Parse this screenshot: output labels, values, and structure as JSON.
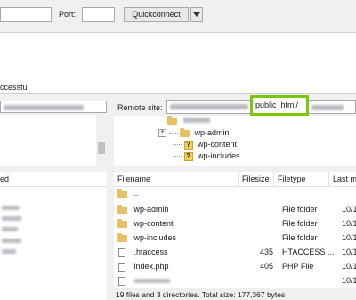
{
  "quickconnect_bar": {
    "port_label": "Port:",
    "quickconnect_label": "Quickconnect",
    "dropdown_icon": "triangle-down-icon"
  },
  "message_log": {
    "visible_line": "ccessful"
  },
  "remote_site": {
    "label": "Remote site:",
    "path_highlight": "public_html/",
    "highlight_color": "#7ac70c"
  },
  "remote_tree": {
    "items": [
      {
        "label": "wp-admin",
        "icon": "folder-icon"
      },
      {
        "label": "wp-content",
        "icon": "question-icon"
      },
      {
        "label": "wp-includes",
        "icon": "question-icon"
      }
    ]
  },
  "local_list": {
    "header_label": "ed"
  },
  "remote_list": {
    "columns": [
      "Filename",
      "Filesize",
      "Filetype",
      "Last m"
    ],
    "rows": [
      {
        "name": "..",
        "size": "",
        "type": "",
        "modified": "",
        "icon": "folder-icon"
      },
      {
        "name": "wp-admin",
        "size": "",
        "type": "File folder",
        "modified": "10/1",
        "icon": "folder-icon"
      },
      {
        "name": "wp-content",
        "size": "",
        "type": "File folder",
        "modified": "10/1",
        "icon": "folder-icon"
      },
      {
        "name": "wp-includes",
        "size": "",
        "type": "File folder",
        "modified": "10/1",
        "icon": "folder-icon"
      },
      {
        "name": ".htaccess",
        "size": "435",
        "type": "HTACCESS ...",
        "modified": "10/1",
        "icon": "file-icon"
      },
      {
        "name": "index.php",
        "size": "405",
        "type": "PHP File",
        "modified": "10/1",
        "icon": "file-icon"
      },
      {
        "name": "",
        "size": "",
        "type": "",
        "modified": "10/1",
        "icon": "file-icon"
      }
    ],
    "status": "19 files and 3 directories. Total size: 177,367 bytes"
  }
}
